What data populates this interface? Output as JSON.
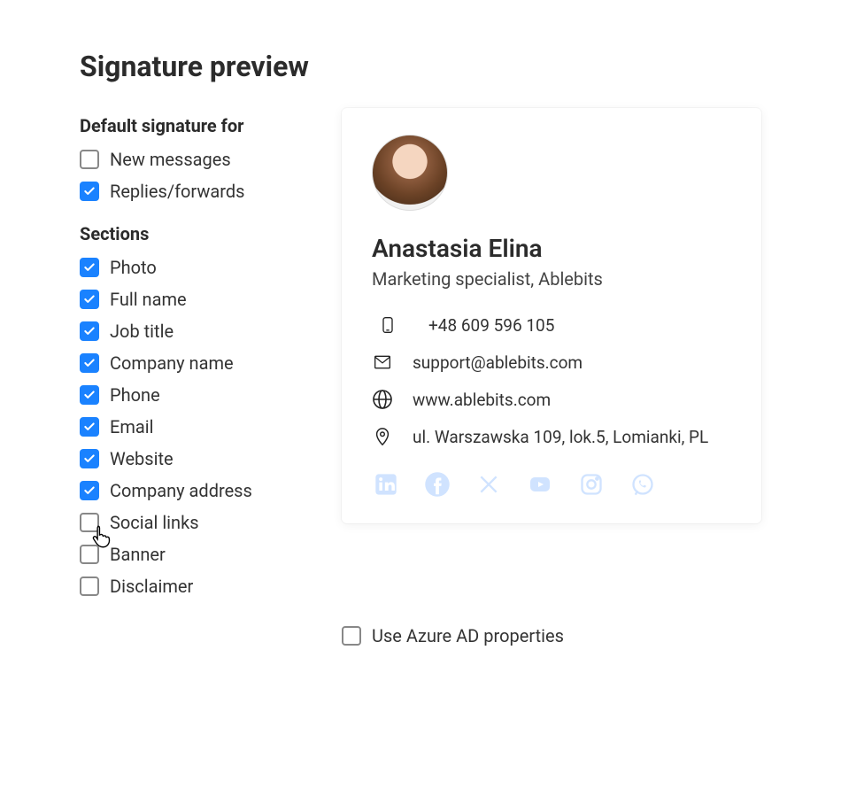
{
  "title": "Signature preview",
  "sidebar": {
    "defaults_title": "Default signature for",
    "defaults": [
      {
        "label": "New messages",
        "checked": false
      },
      {
        "label": "Replies/forwards",
        "checked": true
      }
    ],
    "sections_title": "Sections",
    "sections": [
      {
        "label": "Photo",
        "checked": true
      },
      {
        "label": "Full name",
        "checked": true
      },
      {
        "label": "Job title",
        "checked": true
      },
      {
        "label": "Company name",
        "checked": true
      },
      {
        "label": "Phone",
        "checked": true
      },
      {
        "label": "Email",
        "checked": true
      },
      {
        "label": "Website",
        "checked": true
      },
      {
        "label": "Company address",
        "checked": true
      },
      {
        "label": "Social links",
        "checked": false,
        "hovered": true
      },
      {
        "label": "Banner",
        "checked": false
      },
      {
        "label": "Disclaimer",
        "checked": false
      }
    ]
  },
  "preview": {
    "name": "Anastasia Elina",
    "role": "Marketing specialist, Ablebits",
    "phone": "+48 609 596 105",
    "email": "support@ablebits.com",
    "website": "www.ablebits.com",
    "address": "ul. Warszawska 109, lok.5, Lomianki, PL"
  },
  "footer": {
    "azure_label": "Use Azure AD properties",
    "azure_checked": false
  },
  "social_icons": [
    "linkedin",
    "facebook",
    "x",
    "youtube",
    "instagram",
    "whatsapp"
  ]
}
